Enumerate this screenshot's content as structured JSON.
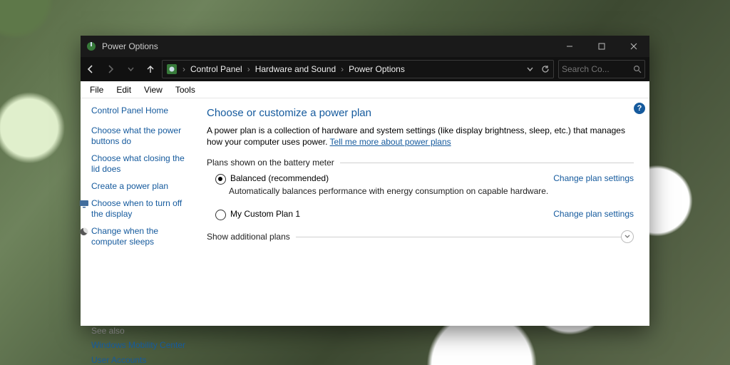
{
  "window": {
    "title": "Power Options"
  },
  "breadcrumb": {
    "root": "Control Panel",
    "mid": "Hardware and Sound",
    "leaf": "Power Options"
  },
  "search": {
    "placeholder": "Search Co..."
  },
  "menu": {
    "file": "File",
    "edit": "Edit",
    "view": "View",
    "tools": "Tools"
  },
  "sidebar": {
    "home": "Control Panel Home",
    "links": [
      "Choose what the power buttons do",
      "Choose what closing the lid does",
      "Create a power plan",
      "Choose when to turn off the display",
      "Change when the computer sleeps"
    ],
    "seealso_title": "See also",
    "seealso": [
      "Windows Mobility Center",
      "User Accounts"
    ]
  },
  "main": {
    "heading": "Choose or customize a power plan",
    "desc_before": "A power plan is a collection of hardware and system settings (like display brightness, sleep, etc.) that manages how your computer uses power. ",
    "desc_link": "Tell me more about power plans",
    "group1_label": "Plans shown on the battery meter",
    "plans": [
      {
        "name": "Balanced (recommended)",
        "desc": "Automatically balances performance with energy consumption on capable hardware.",
        "change": "Change plan settings",
        "selected": true
      },
      {
        "name": "My Custom Plan 1",
        "desc": "",
        "change": "Change plan settings",
        "selected": false
      }
    ],
    "group2_label": "Show additional plans"
  }
}
